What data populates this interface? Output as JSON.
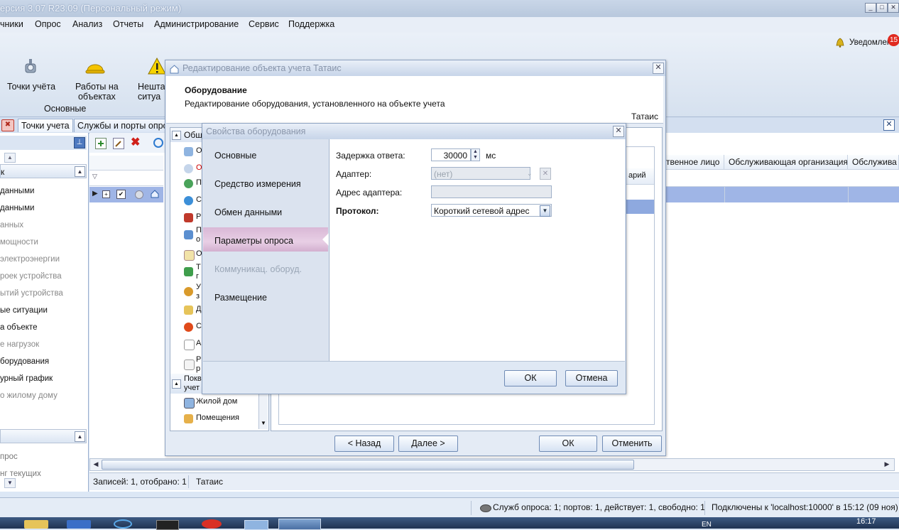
{
  "app": {
    "title": "ерсия 3.07 R23.09 (Персональный режим)",
    "min": "_",
    "max": "□",
    "close": "✕"
  },
  "menu": [
    "чники",
    "Опрос",
    "Анализ",
    "Отчеты",
    "Администрирование",
    "Сервис",
    "Поддержка"
  ],
  "notifications": {
    "label": "Уведомлен",
    "count": "15"
  },
  "ribbon": {
    "points_label": "Точки учёта",
    "works_label": "Работы на\nобъектах",
    "emergency_label": "Нешта\nситуа",
    "group_label": "Основные"
  },
  "tabs": [
    "Точки учета",
    "Службы и порты опроса"
  ],
  "left_panel": {
    "section_title": "к",
    "items": [
      "данными",
      "данными",
      "анных",
      "мощности",
      "электроэнергии",
      "роек устройства",
      "ытий устройства",
      "ые ситуации",
      "а объекте",
      "е нагрузок",
      "борудования",
      "урный график",
      "о жилому дому"
    ],
    "bottom_items": [
      "прос",
      "нг текущих"
    ]
  },
  "grid": {
    "headers": [
      "ственное лицо",
      "Обслуживающая организация",
      "Обслужива"
    ],
    "inner_header": "арий"
  },
  "status": {
    "records": "Записей: 1, отобрано: 1",
    "object": "Татаис",
    "services": "Служб опроса: 1; портов: 1, действует: 1, свободно: 1",
    "connection": "Подключены к 'localhost:10000' в 15:12 (09 ноя)"
  },
  "taskbar": {
    "lang": "EN",
    "time": "16:17"
  },
  "edit_dialog": {
    "title": "Редактирование объекта учета Татаис",
    "header_title": "Оборудование",
    "header_desc": "Редактирование оборудования, установленного на объекте учета",
    "object_name": "Татаис",
    "tree_group1": "Общ",
    "tree_items": [
      "О",
      "О",
      "П",
      "С",
      "Р",
      "П\nо",
      "О",
      "Т\nг",
      "У\nз",
      "Д",
      "С",
      "А",
      "Р\nр"
    ],
    "tree_group2": "Покв\nучет",
    "tree_bottom": [
      "Жилой дом",
      "Помещения"
    ],
    "back": "< Назад",
    "next": "Далее >",
    "ok": "ОК",
    "cancel": "Отменить"
  },
  "props_dialog": {
    "title": "Свойства оборудования",
    "nav": [
      "Основные",
      "Средство измерения",
      "Обмен данными",
      "Параметры опроса",
      "Коммуникац. оборуд.",
      "Размещение"
    ],
    "selected_nav": "Параметры опроса",
    "fields": {
      "delay_label": "Задержка ответа:",
      "delay_value": "30000",
      "delay_unit": "мс",
      "adapter_label": "Адаптер:",
      "adapter_value": "(нет)",
      "adapter_addr_label": "Адрес адаптера:",
      "adapter_addr_value": "",
      "protocol_label": "Протокол:",
      "protocol_value": "Короткий сетевой адрес"
    },
    "ok": "ОК",
    "cancel": "Отмена"
  }
}
